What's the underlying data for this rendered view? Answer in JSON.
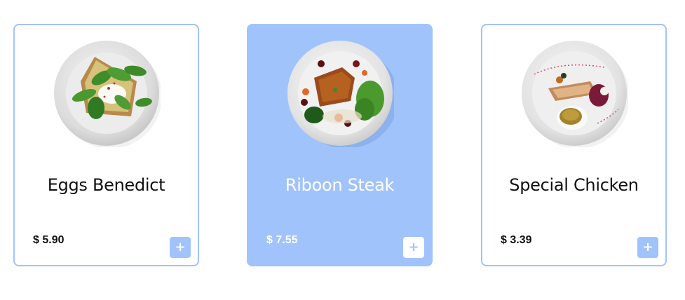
{
  "colors": {
    "accent": "#a1c3fb",
    "border": "#a3c2fb",
    "text": "#111111",
    "active_text": "#ffffff"
  },
  "cards": [
    {
      "name": "Eggs Benedict",
      "price": "$ 5.90",
      "add_icon": "+",
      "active": false,
      "image": "eggs-benedict-plate"
    },
    {
      "name": "Riboon Steak",
      "price": "$ 7.55",
      "add_icon": "+",
      "active": true,
      "image": "steak-plate"
    },
    {
      "name": "Special Chicken",
      "price": "$ 3.39",
      "add_icon": "+",
      "active": false,
      "image": "chicken-plate"
    }
  ]
}
